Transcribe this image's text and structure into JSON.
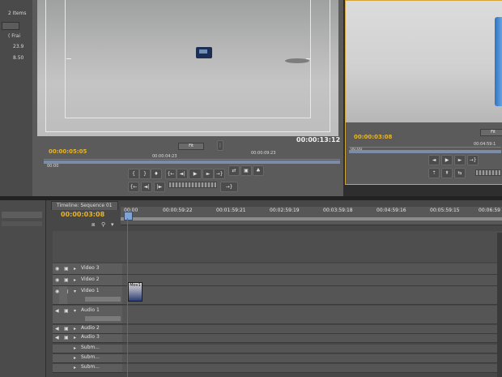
{
  "left_panel": {
    "lines": [
      "2 Items",
      "",
      "( Frai",
      "23.9",
      "8.50"
    ]
  },
  "source_monitor": {
    "timecode_in": "00:00:05:05",
    "timecode_out": "00:00:13:12",
    "ruler_start": "00:00",
    "ruler_marks": [
      "00:00:04:23",
      "00:00:09:23"
    ],
    "fit_label": "Fit",
    "transport_buttons": [
      "{",
      "}",
      "♦",
      "{←",
      "→}",
      "◄|",
      "◄",
      "▶",
      "►",
      "|►",
      "⇄",
      "▣",
      "♣"
    ],
    "transport_row2": [
      "{←",
      "◄|",
      "|►",
      "→}"
    ]
  },
  "program_monitor": {
    "timecode_in": "00:00:03:08",
    "timecode_out": "00:00:",
    "ruler_start": "00:00",
    "ruler_marks": [
      "00:04:59:1"
    ],
    "fit_label": "Fit"
  },
  "timeline": {
    "tab_label": "Timeline: Sequence 01",
    "timecode": "00:00:03:08",
    "ruler_labels": [
      "00:00",
      "00:00:59:22",
      "00:01:59:21",
      "00:02:59:19",
      "00:03:59:18",
      "00:04:59:16",
      "00:05:59:15",
      "00:06:59"
    ],
    "video_tracks": [
      "Video 3",
      "Video 2",
      "Video 1"
    ],
    "audio_tracks": [
      "Audio 1",
      "Audio 2",
      "Audio 3",
      "Subm...",
      "Subm...",
      "Subm..."
    ],
    "clip_label": "Mov1"
  }
}
